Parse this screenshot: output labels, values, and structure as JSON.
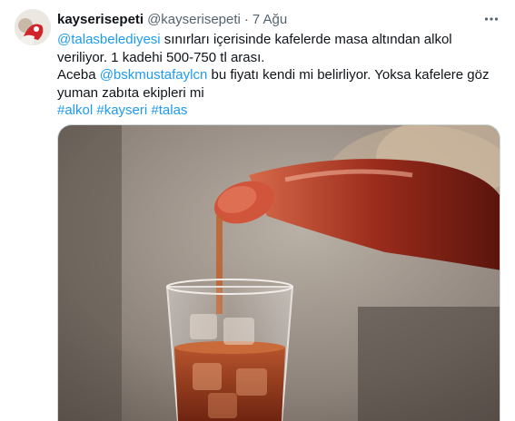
{
  "author": {
    "display_name": "kayserisepeti",
    "handle": "@kayserisepeti",
    "separator": "·",
    "time": "7 Ağu"
  },
  "tweet": {
    "mention1": "@talasbelediyesi",
    "line1_rest": " sınırları içerisinde kafelerde masa altından alkol veriliyor. 1 kadehi 500-750 tl arası.",
    "line2_start": "Aceba ",
    "mention2": "@bskmustafaylcn",
    "line2_rest": " bu fiyatı kendi mi belirliyor. Yoksa kafelere göz yuman zabıta ekipleri mi",
    "hashtags": [
      {
        "text": "#alkol"
      },
      {
        "text": "#kayseri"
      },
      {
        "text": "#talas"
      }
    ]
  },
  "icons": {
    "more": "more-dots-icon",
    "avatar": "avatar-image"
  },
  "colors": {
    "link": "#1d9bf0",
    "text": "#0f1419",
    "secondary": "#536471"
  }
}
